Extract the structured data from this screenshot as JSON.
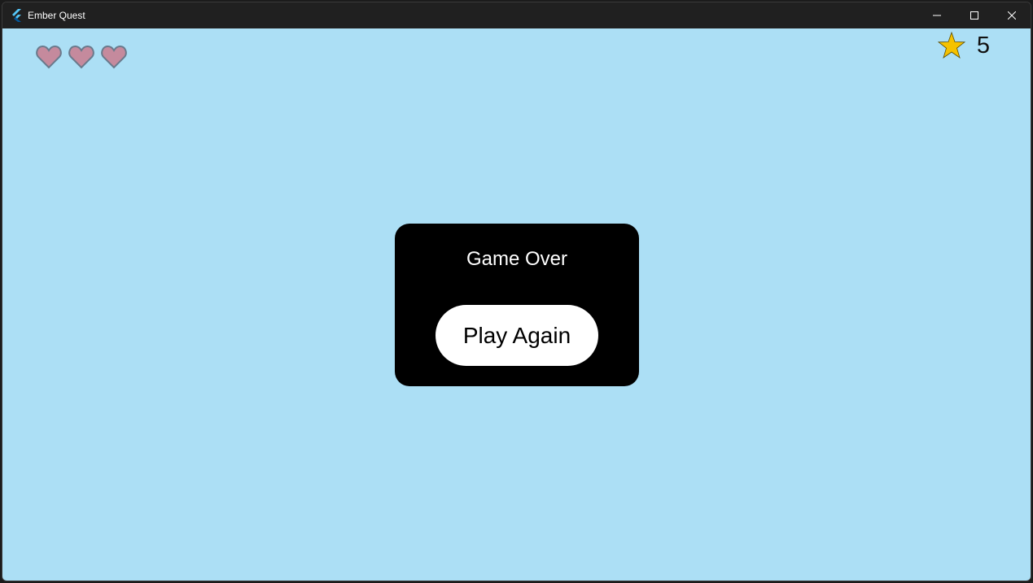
{
  "window": {
    "title": "Ember Quest",
    "app_icon": "flutter-icon"
  },
  "window_controls": [
    "minimize-icon",
    "maximize-icon",
    "close-icon"
  ],
  "colors": {
    "sky": "#acdff5",
    "heart_fill": "#c58a9d",
    "heart_outline": "#6a7a8c",
    "star_fill": "#f5c200",
    "dialog_bg": "#000000",
    "button_bg": "#ffffff"
  },
  "hud": {
    "lives": 3,
    "lives_icon": "heart-icon",
    "score_icon": "star-icon",
    "score": "5"
  },
  "dialog": {
    "title": "Game Over",
    "button_label": "Play Again"
  }
}
